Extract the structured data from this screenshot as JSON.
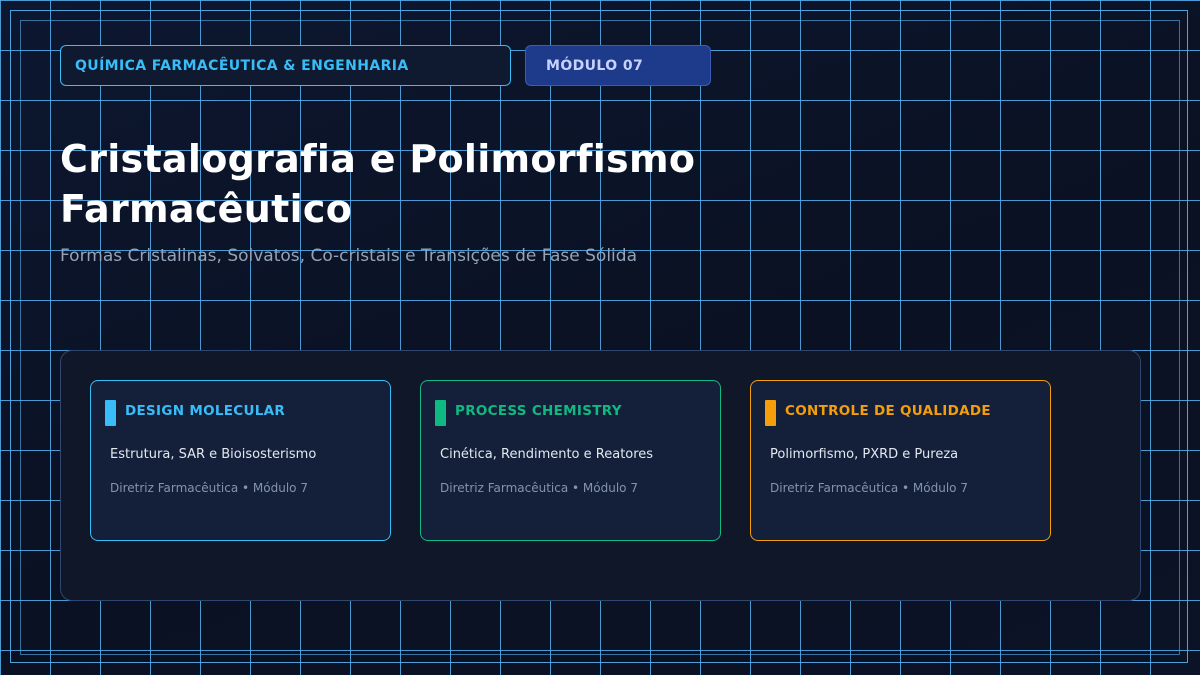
{
  "header": {
    "category_label": "QUÍMICA FARMACÊUTICA & ENGENHARIA",
    "module_label": "MÓDULO 07"
  },
  "hero": {
    "title": "Cristalografia e Polimorfismo Farmacêutico",
    "subtitle": "Formas Cristalinas, Solvatos, Co-cristais e Transições de Fase Sólida"
  },
  "cards": [
    {
      "title": "DESIGN MOLECULAR",
      "description": "Estrutura, SAR e Bioisosterismo",
      "meta": "Diretriz Farmacêutica • Módulo 7",
      "accent": "#38bdf8"
    },
    {
      "title": "PROCESS CHEMISTRY",
      "description": "Cinética, Rendimento e Reatores",
      "meta": "Diretriz Farmacêutica • Módulo 7",
      "accent": "#10b981"
    },
    {
      "title": "CONTROLE DE QUALIDADE",
      "description": "Polimorfismo, PXRD e Pureza",
      "meta": "Diretriz Farmacêutica • Módulo 7",
      "accent": "#f59e0b"
    }
  ],
  "colors": {
    "background": "#0b1224",
    "grid": "#56b0f0",
    "title": "#ffffff",
    "subtitle": "#94a3b8"
  }
}
